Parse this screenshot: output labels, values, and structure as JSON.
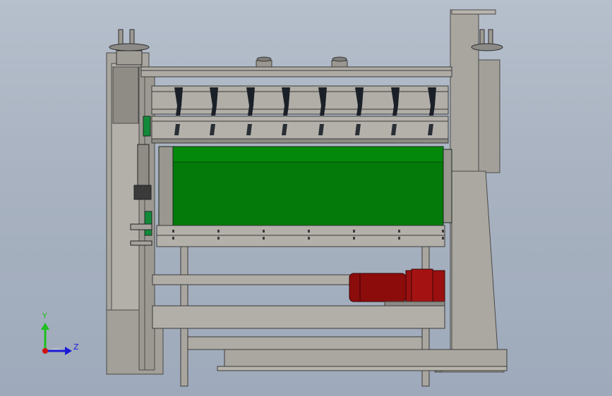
{
  "viewport": {
    "background_top": "#b6bfcc",
    "background_bottom": "#9eaabb"
  },
  "colors": {
    "frame": "#a9a6a0",
    "frame_dark": "#4b4a48",
    "green_roller": "#037a09",
    "green_roller_dark": "#025e06",
    "motor_red": "#8c0c0c",
    "knife_black": "#1b2028",
    "green_bracket": "#128a3a"
  },
  "triad": {
    "y_label": "Y",
    "z_label": "Z",
    "y_color": "#1fbf1f",
    "z_color": "#1a1ad6",
    "x_color": "#d01010"
  }
}
